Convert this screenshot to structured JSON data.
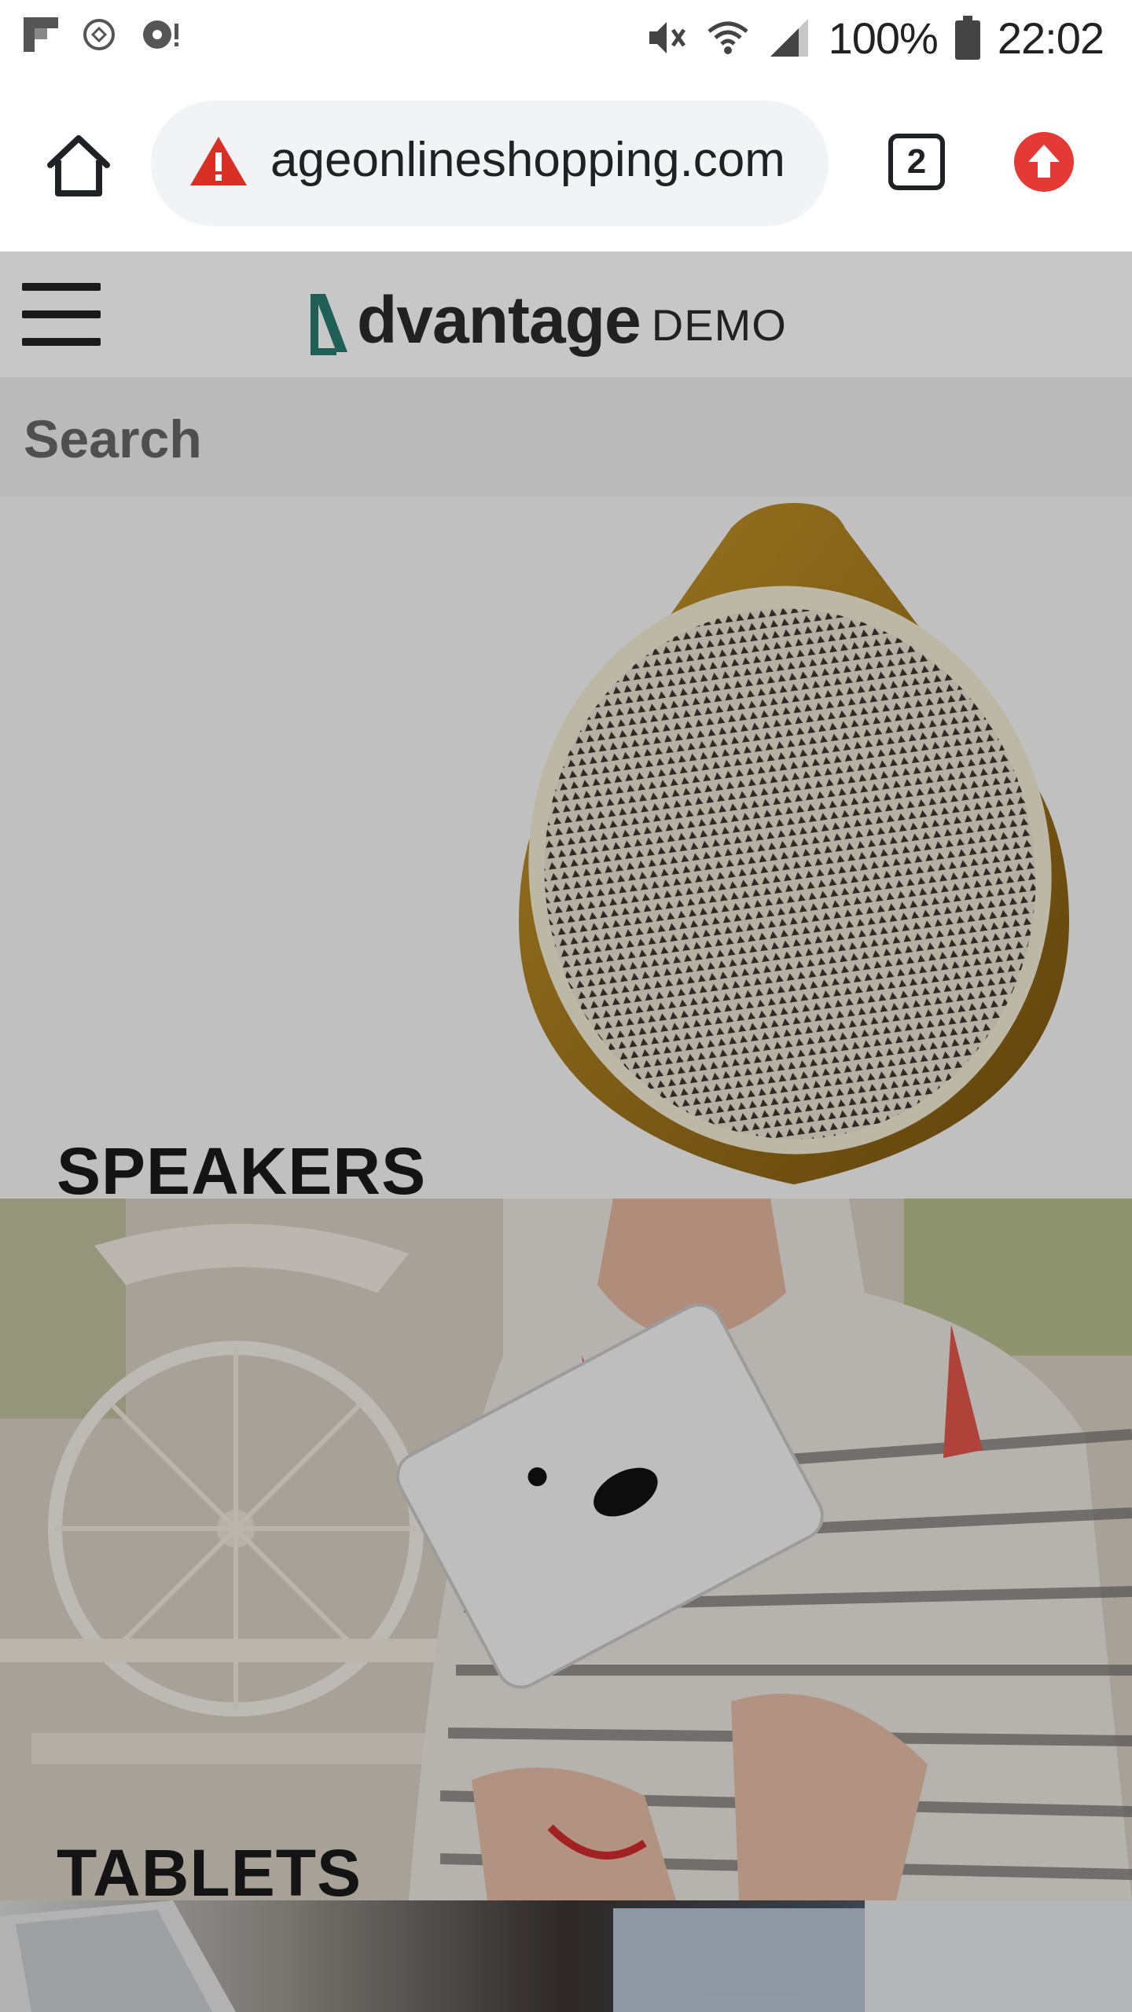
{
  "status_bar": {
    "battery": "100%",
    "time": "22:02"
  },
  "browser": {
    "url": "ageonlineshopping.com",
    "tab_count": "2"
  },
  "site": {
    "logo_word": "dvantage",
    "logo_demo": "DEMO",
    "search_label": "Search"
  },
  "categories": [
    {
      "title": "SPEAKERS"
    },
    {
      "title": "TABLETS"
    }
  ],
  "colors": {
    "logo_accent": "#2a7a6f",
    "warning_red": "#d93025",
    "update_red": "#e53935"
  }
}
